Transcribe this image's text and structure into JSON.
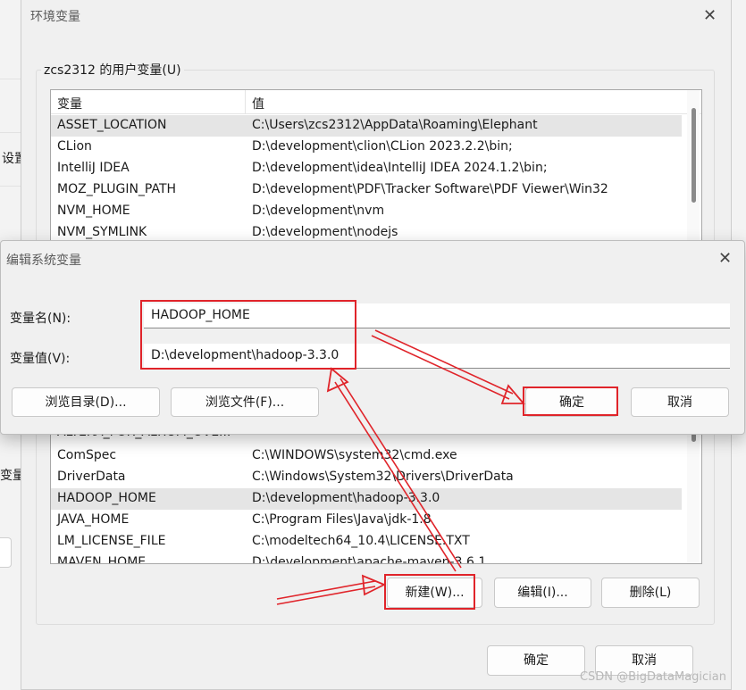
{
  "background": {
    "fragments": [
      "设置",
      "变量"
    ]
  },
  "env_dialog": {
    "title": "环境变量",
    "user_vars_label": "zcs2312 的用户变量(U)",
    "columns": [
      "变量",
      "值"
    ],
    "user_vars": [
      {
        "name": "ASSET_LOCATION",
        "value": "C:\\Users\\zcs2312\\AppData\\Roaming\\Elephant",
        "selected": true
      },
      {
        "name": "CLion",
        "value": "D:\\development\\clion\\CLion 2023.2.2\\bin;"
      },
      {
        "name": "IntelliJ IDEA",
        "value": "D:\\development\\idea\\IntelliJ IDEA 2024.1.2\\bin;"
      },
      {
        "name": "MOZ_PLUGIN_PATH",
        "value": "D:\\development\\PDF\\Tracker Software\\PDF Viewer\\Win32"
      },
      {
        "name": "NVM_HOME",
        "value": "D:\\development\\nvm"
      },
      {
        "name": "NVM_SYMLINK",
        "value": "D:\\development\\nodejs"
      }
    ],
    "system_vars": [
      {
        "name": "ALTERA_FOR_ALTIUM_OVE...",
        "value": ""
      },
      {
        "name": "ComSpec",
        "value": "C:\\WINDOWS\\system32\\cmd.exe"
      },
      {
        "name": "DriverData",
        "value": "C:\\Windows\\System32\\Drivers\\DriverData"
      },
      {
        "name": "HADOOP_HOME",
        "value": "D:\\development\\hadoop-3.3.0",
        "selected": true
      },
      {
        "name": "JAVA_HOME",
        "value": "C:\\Program Files\\Java\\jdk-1.8"
      },
      {
        "name": "LM_LICENSE_FILE",
        "value": "C:\\modeltech64_10.4\\LICENSE.TXT"
      },
      {
        "name": "MAVEN_HOME",
        "value": "D:\\development\\apache-maven-3.6.1"
      }
    ],
    "buttons": {
      "new": "新建(W)...",
      "edit": "编辑(I)...",
      "delete": "删除(L)"
    },
    "ok": "确定",
    "cancel": "取消"
  },
  "edit_dialog": {
    "title": "编辑系统变量",
    "name_label": "变量名(N):",
    "value_label": "变量值(V):",
    "name_value": "HADOOP_HOME",
    "value_value": "D:\\development\\hadoop-3.3.0",
    "browse_dir": "浏览目录(D)...",
    "browse_file": "浏览文件(F)...",
    "ok": "确定",
    "cancel": "取消"
  },
  "close_glyph": "✕",
  "watermark": "CSDN @BigDataMagician",
  "colors": {
    "annotation_red": "#e0242a",
    "selection": "#e5e5e5"
  }
}
